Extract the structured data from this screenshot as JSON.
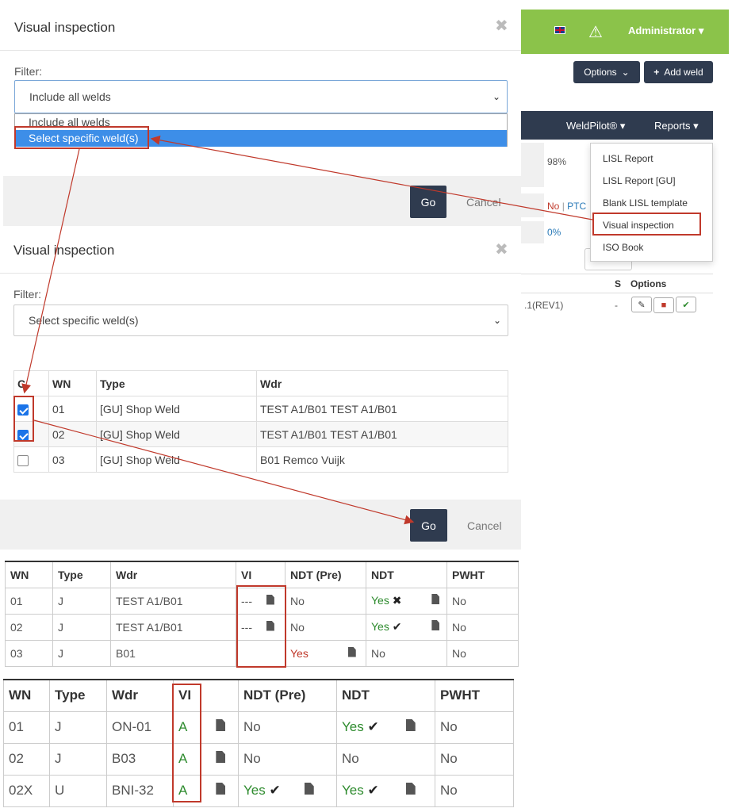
{
  "app": {
    "language_flag": "uk-flag-icon",
    "warning_icon": "warning-icon",
    "user": "Administrator",
    "options_label": "Options",
    "add_weld_label": "Add weld",
    "weldpilot_label": "WeldPilot®",
    "reports_label": "Reports",
    "reports_menu": [
      "LISL Report",
      "LISL Report [GU]",
      "Blank LISL template",
      "Visual inspection",
      "ISO Book"
    ],
    "bg_values": {
      "pct1": "98%",
      "no": "No",
      "ptc": "PTC",
      "pct2": "0%"
    },
    "bg_table": {
      "col_s": "S",
      "col_options": "Options",
      "row_wdr": ".1(REV1)",
      "row_s": "-"
    }
  },
  "modal1": {
    "title": "Visual inspection",
    "filter_label": "Filter:",
    "select_value": "Include all welds",
    "options": [
      "Include all welds",
      "Select specific weld(s)"
    ],
    "go": "Go",
    "cancel": "Cancel"
  },
  "modal2": {
    "title": "Visual inspection",
    "filter_label": "Filter:",
    "select_value": "Select specific weld(s)",
    "headers": [
      "C",
      "WN",
      "Type",
      "Wdr"
    ],
    "rows": [
      {
        "checked": true,
        "wn": "01",
        "type": "[GU] Shop Weld",
        "wdr": "TEST A1/B01 TEST A1/B01"
      },
      {
        "checked": true,
        "wn": "02",
        "type": "[GU] Shop Weld",
        "wdr": "TEST A1/B01 TEST A1/B01"
      },
      {
        "checked": false,
        "wn": "03",
        "type": "[GU] Shop Weld",
        "wdr": "B01 Remco Vuijk"
      }
    ],
    "go": "Go",
    "cancel": "Cancel"
  },
  "table_before": {
    "headers": [
      "WN",
      "Type",
      "Wdr",
      "VI",
      "NDT (Pre)",
      "NDT",
      "PWHT"
    ],
    "rows": [
      {
        "wn": "01",
        "type": "J",
        "wdr": "TEST A1/B01",
        "vi": "---",
        "ndt_pre": "No",
        "ndt": "Yes",
        "pwht": "No"
      },
      {
        "wn": "02",
        "type": "J",
        "wdr": "TEST A1/B01",
        "vi": "---",
        "ndt_pre": "No",
        "ndt": "Yes",
        "pwht": "No"
      },
      {
        "wn": "03",
        "type": "J",
        "wdr": "B01",
        "vi": "",
        "ndt_pre": "Yes",
        "ndt": "No",
        "pwht": "No"
      }
    ]
  },
  "table_after": {
    "headers": [
      "WN",
      "Type",
      "Wdr",
      "VI",
      "NDT (Pre)",
      "NDT",
      "PWHT"
    ],
    "rows": [
      {
        "wn": "01",
        "type": "J",
        "wdr": "ON-01",
        "vi": "A",
        "ndt_pre": "No",
        "ndt": "Yes",
        "pwht": "No"
      },
      {
        "wn": "02",
        "type": "J",
        "wdr": "B03",
        "vi": "A",
        "ndt_pre": "No",
        "ndt": "No",
        "pwht": "No"
      },
      {
        "wn": "02X",
        "type": "U",
        "wdr": "BNI-32",
        "vi": "A",
        "ndt_pre": "Yes",
        "ndt": "Yes",
        "pwht": "No"
      }
    ]
  },
  "colors": {
    "accent_green": "#8bc34a",
    "navy": "#2f3b4f",
    "highlight_blue": "#3d8ee8",
    "annotation_red": "#c0392b"
  }
}
